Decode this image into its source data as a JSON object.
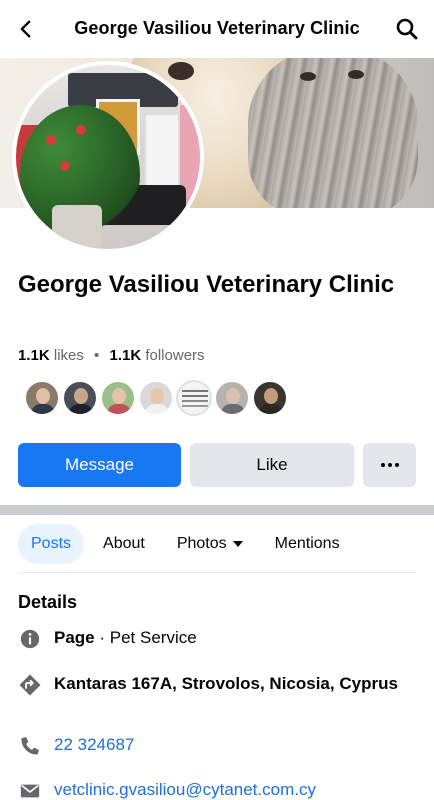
{
  "header": {
    "title": "George Vasiliou Veterinary Clinic"
  },
  "page": {
    "name": "George Vasiliou Veterinary Clinic",
    "likes_count": "1.1K",
    "likes_label": "likes",
    "separator": "•",
    "followers_count": "1.1K",
    "followers_label": "followers"
  },
  "actions": {
    "message_label": "Message",
    "like_label": "Like"
  },
  "tabs": [
    {
      "label": "Posts",
      "active": true
    },
    {
      "label": "About",
      "active": false
    },
    {
      "label": "Photos",
      "active": false,
      "has_dropdown": true
    },
    {
      "label": "Mentions",
      "active": false
    }
  ],
  "details": {
    "title": "Details",
    "category_prefix": "Page",
    "category_value": " · Pet Service",
    "address": "Kantaras 167A, Strovolos, Nicosia, Cyprus",
    "phone": "22 324687",
    "email": "vetclinic.gvasiliou@cytanet.com.cy"
  },
  "icons": {
    "back": "chevron-left-icon",
    "search": "search-icon",
    "more": "more-dots-icon",
    "info": "info-icon",
    "directions": "directions-icon",
    "phone": "phone-icon",
    "email": "mail-icon"
  },
  "colors": {
    "primary": "#1877f2",
    "secondary_button": "#e4e6eb",
    "active_tab_bg": "#e7f3ff",
    "link": "#216fdb",
    "muted_text": "#65676b"
  }
}
